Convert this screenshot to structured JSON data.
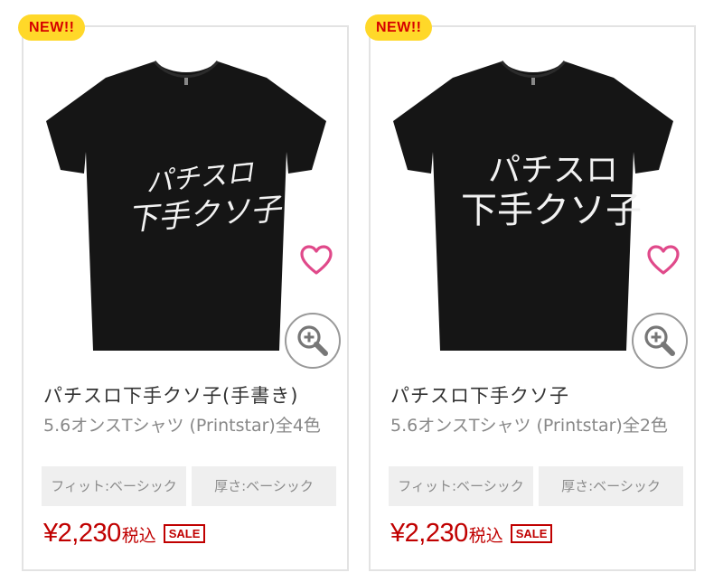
{
  "products": [
    {
      "badge": "NEW!!",
      "print_line1": "パチスロ",
      "print_line2": "下手クソ子",
      "title": "パチスロ下手クソ子(手書き)",
      "subtitle": "5.6オンスTシャツ (Printstar)全4色",
      "specs": [
        "フィット:ベーシック",
        "厚さ:ベーシック"
      ],
      "price": "¥2,230",
      "tax_label": "税込",
      "sale_label": "SALE"
    },
    {
      "badge": "NEW!!",
      "print_line1": "パチスロ",
      "print_line2": "下手クソ子",
      "title": "パチスロ下手クソ子",
      "subtitle": "5.6オンスTシャツ (Printstar)全2色",
      "specs": [
        "フィット:ベーシック",
        "厚さ:ベーシック"
      ],
      "price": "¥2,230",
      "tax_label": "税込",
      "sale_label": "SALE"
    }
  ],
  "colors": {
    "badge_bg": "#ffd829",
    "badge_text": "#d60000",
    "price": "#c00000",
    "heart": "#e0498a",
    "shirt": "#151515"
  },
  "icons": [
    "heart-icon",
    "zoom-in-icon"
  ]
}
